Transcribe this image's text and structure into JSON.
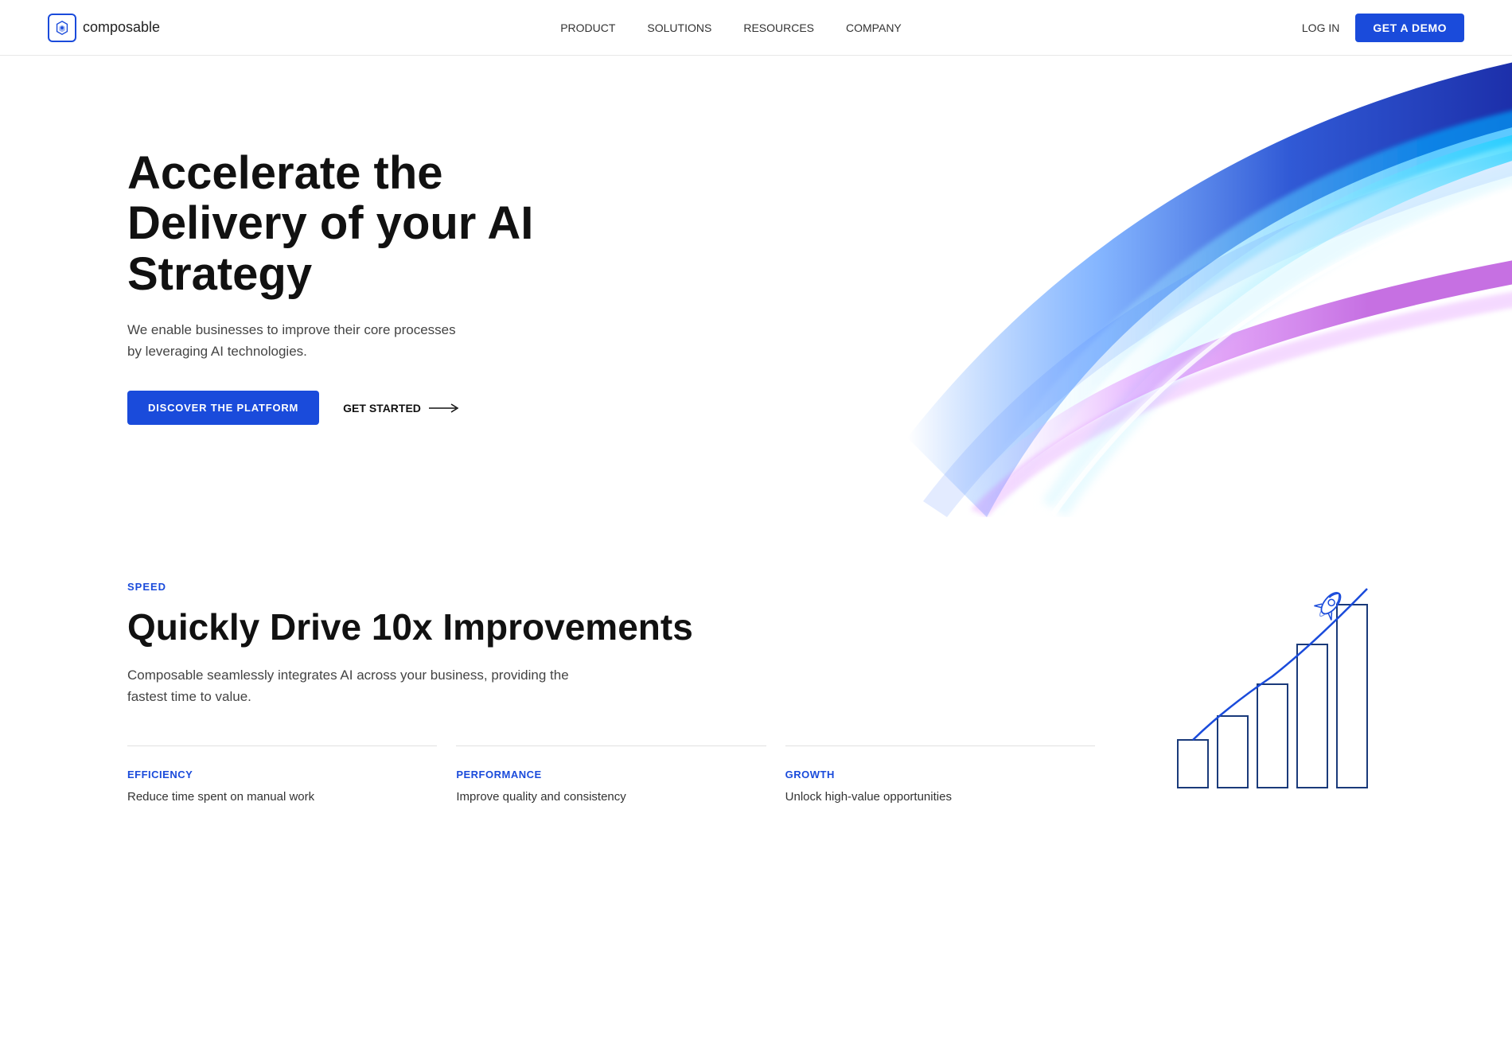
{
  "nav": {
    "logo_text": "composable",
    "links": [
      {
        "label": "PRODUCT"
      },
      {
        "label": "SOLUTIONS"
      },
      {
        "label": "RESOURCES"
      },
      {
        "label": "COMPANY"
      }
    ],
    "login_label": "LOG IN",
    "demo_label": "GET A DEMO"
  },
  "hero": {
    "title": "Accelerate the Delivery of your AI Strategy",
    "subtitle": "We enable businesses to improve their core processes by leveraging AI technologies.",
    "btn_discover": "DISCOVER THE PLATFORM",
    "btn_get_started": "GET STARTED"
  },
  "speed_section": {
    "label": "SPEED",
    "title": "Quickly Drive 10x Improvements",
    "description": "Composable seamlessly integrates AI across your business, providing the fastest time to value.",
    "benefits": [
      {
        "label": "EFFICIENCY",
        "description": "Reduce time spent on manual work"
      },
      {
        "label": "PERFORMANCE",
        "description": "Improve quality and consistency"
      },
      {
        "label": "GROWTH",
        "description": "Unlock high-value opportunities"
      }
    ]
  },
  "colors": {
    "brand_blue": "#1a4bdb",
    "dark_navy": "#1a3a7a"
  }
}
